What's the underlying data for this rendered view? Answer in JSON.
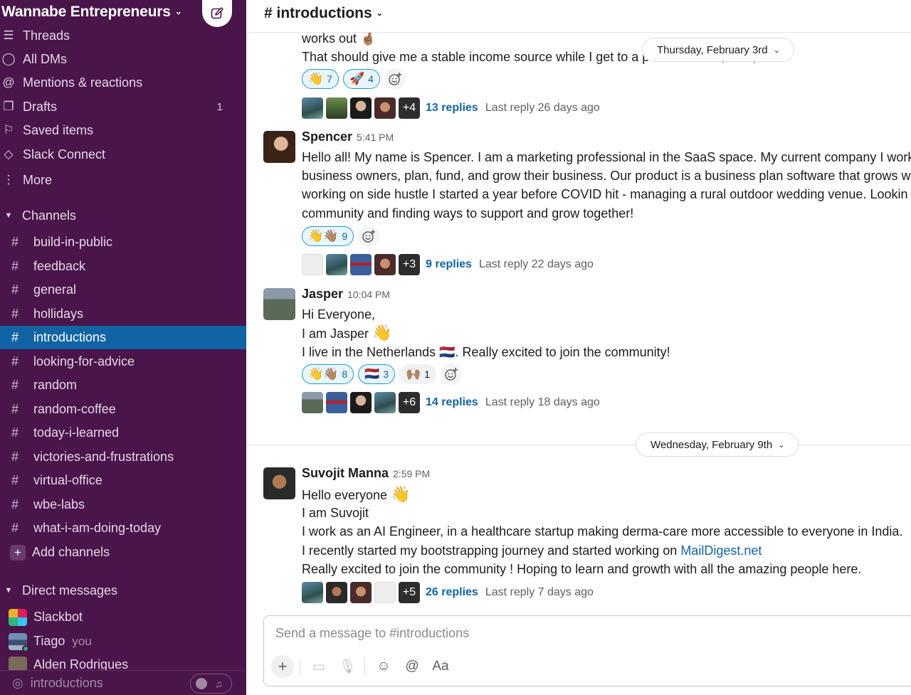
{
  "workspace": {
    "name": "Wannabe Entrepreneurs"
  },
  "nav": [
    {
      "label": "Threads",
      "icon": "threads-icon"
    },
    {
      "label": "All DMs",
      "icon": "dms-icon"
    },
    {
      "label": "Mentions & reactions",
      "icon": "at-icon"
    },
    {
      "label": "Drafts",
      "icon": "drafts-icon",
      "count": "1"
    },
    {
      "label": "Saved items",
      "icon": "bookmark-icon"
    },
    {
      "label": "Slack Connect",
      "icon": "connect-icon"
    },
    {
      "label": "More",
      "icon": "more-icon"
    }
  ],
  "channels_section": {
    "title": "Channels",
    "items": [
      "build-in-public",
      "feedback",
      "general",
      "hollidays",
      "introductions",
      "looking-for-advice",
      "random",
      "random-coffee",
      "today-i-learned",
      "victories-and-frustrations",
      "virtual-office",
      "wbe-labs",
      "what-i-am-doing-today"
    ],
    "active": "introductions",
    "add_label": "Add channels"
  },
  "dm_section": {
    "title": "Direct messages",
    "items": [
      {
        "name": "Slackbot"
      },
      {
        "name": "Tiago",
        "suffix": "you"
      },
      {
        "name": "Alden Rodrigues"
      }
    ]
  },
  "huddle": {
    "channel": "introductions"
  },
  "channel": {
    "title": "# introductions"
  },
  "date_dividers": [
    "Thursday, February 3rd",
    "Wednesday, February 9th"
  ],
  "messages": [
    {
      "partial": true,
      "lines": [
        "works out 🤞🏽",
        "That should give me a stable income source while I get to a point in ARR."
      ],
      "edited": "(edited)",
      "reactions": [
        {
          "emoji": "👋",
          "count": "7"
        },
        {
          "emoji": "🚀",
          "count": "4"
        }
      ],
      "thread": {
        "more": "+4",
        "replies": "13 replies",
        "last": "Last reply 26 days ago"
      }
    },
    {
      "sender": "Spencer",
      "time": "5:41 PM",
      "lines": [
        "Hello all! My name is Spencer. I am a marketing professional in the SaaS space. My current company I work",
        "business owners, plan, fund, and grow their business. Our product is a business plan software that grows w",
        "working on side hustle I started a year before COVID hit - managing a rural outdoor wedding venue. Lookin",
        "community and finding ways to support and grow together!"
      ],
      "reactions": [
        {
          "emoji": "👋👋🏽",
          "count": "9"
        }
      ],
      "thread": {
        "more": "+3",
        "replies": "9 replies",
        "last": "Last reply 22 days ago"
      }
    },
    {
      "sender": "Jasper",
      "time": "10:04 PM",
      "lines": [
        "Hi Everyone,",
        "I am Jasper",
        "I live in the Netherlands",
        ". Really excited to join the community!"
      ],
      "reactions": [
        {
          "emoji": "👋👋🏽",
          "count": "8"
        },
        {
          "emoji": "🇳🇱",
          "count": "3"
        },
        {
          "emoji": "🙌🏽",
          "count": "1"
        }
      ],
      "thread": {
        "more": "+6",
        "replies": "14 replies",
        "last": "Last reply 18 days ago"
      }
    },
    {
      "sender": "Suvojit Manna",
      "time": "2:59 PM",
      "lines": [
        "Hello everyone",
        "I am Suvojit",
        "I work as an AI Engineer, in a healthcare startup making derma-care more accessible to everyone in India.",
        "I recently started my bootstrapping journey and started working on",
        "Really excited to join the community ! Hoping to learn and growth with all the amazing people here."
      ],
      "link": "MailDigest.net",
      "thread": {
        "more": "+5",
        "replies": "26 replies",
        "last": "Last reply 7 days ago"
      }
    }
  ],
  "composer": {
    "placeholder": "Send a message to #introductions",
    "format_label": "Aa"
  },
  "colors": {
    "sidebar": "#4a154b",
    "active": "#1164a3",
    "link": "#1264a3",
    "presence": "#2bac76"
  }
}
